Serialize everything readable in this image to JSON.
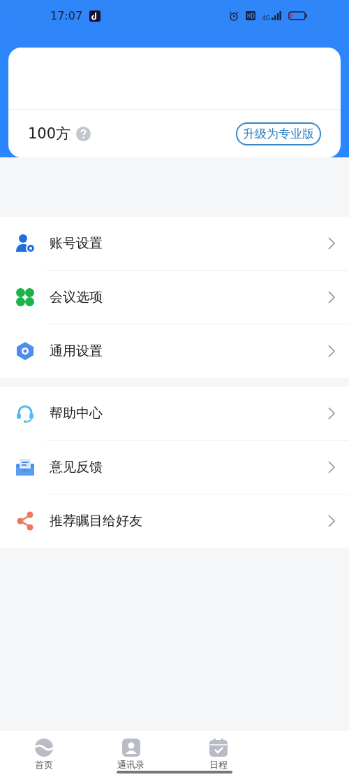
{
  "status_bar": {
    "time": "17:07",
    "network": "4G"
  },
  "account_card": {
    "quota": "100方",
    "upgrade_button": "升级为专业版"
  },
  "menu_sections": [
    {
      "items": [
        {
          "label": "账号设置"
        },
        {
          "label": "会议选项"
        },
        {
          "label": "通用设置"
        }
      ]
    },
    {
      "items": [
        {
          "label": "帮助中心"
        },
        {
          "label": "意见反馈"
        },
        {
          "label": "推荐瞩目给好友"
        }
      ]
    }
  ],
  "bottom_nav": [
    {
      "label": "首页",
      "selected": false
    },
    {
      "label": "通讯录",
      "selected": false
    },
    {
      "label": "日程",
      "selected": false
    }
  ]
}
